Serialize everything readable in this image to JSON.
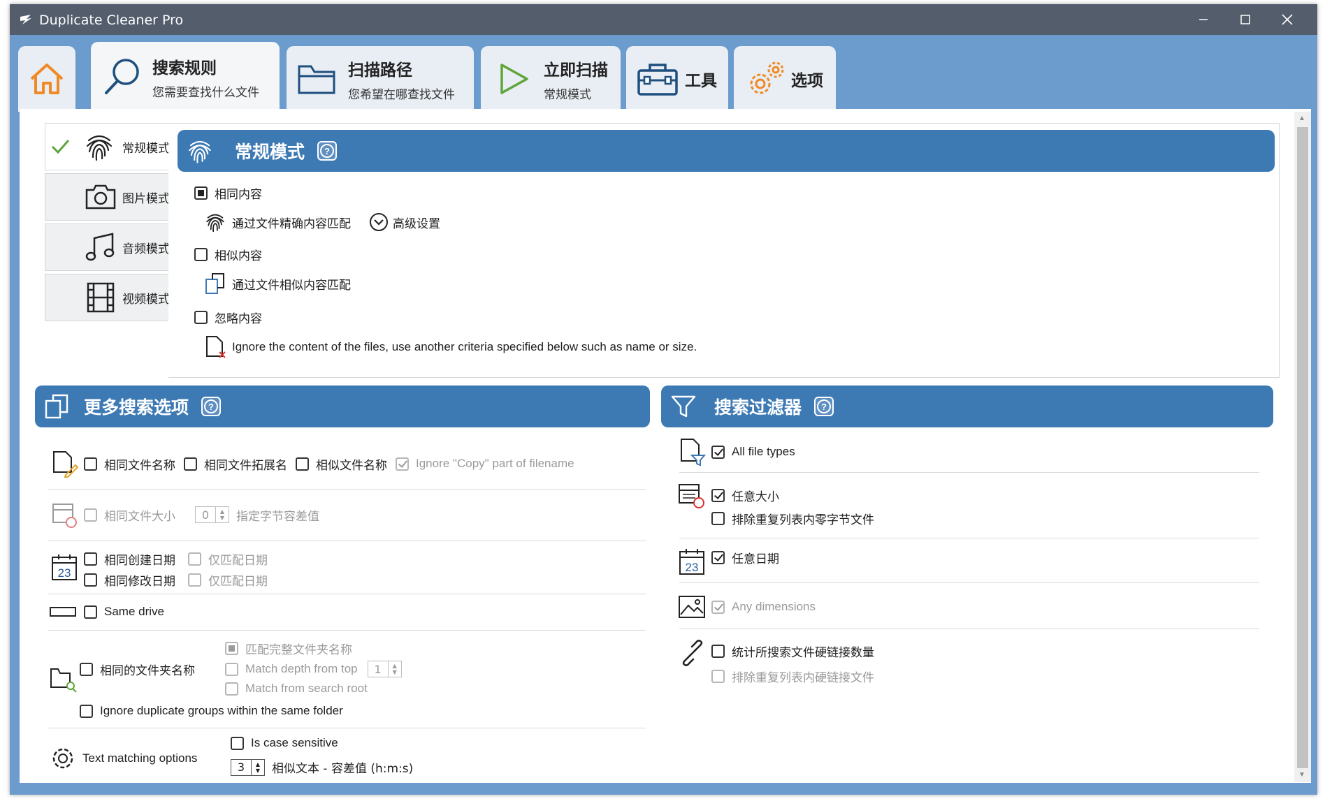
{
  "window": {
    "title": "Duplicate Cleaner Pro"
  },
  "tabs": [
    {
      "id": "home",
      "label": "",
      "sub": ""
    },
    {
      "id": "search",
      "label": "搜索规则",
      "sub": "您需要查找什么文件"
    },
    {
      "id": "paths",
      "label": "扫描路径",
      "sub": "您希望在哪查找文件"
    },
    {
      "id": "scan",
      "label": "立即扫描",
      "sub": "常规模式"
    },
    {
      "id": "tools",
      "label": "工具",
      "sub": ""
    },
    {
      "id": "options",
      "label": "选项",
      "sub": ""
    }
  ],
  "modes": [
    {
      "label": "常规模式",
      "selected": true
    },
    {
      "label": "图片模式",
      "selected": false
    },
    {
      "label": "音频模式",
      "selected": false
    },
    {
      "label": "视频模式",
      "selected": false
    }
  ],
  "mode_panel": {
    "title": "常规模式",
    "same_content": "相同内容",
    "same_content_desc": "通过文件精确内容匹配",
    "advanced": "高级设置",
    "similar_content": "相似内容",
    "similar_content_desc": "通过文件相似内容匹配",
    "ignore_content": "忽略内容",
    "ignore_content_desc": "Ignore the content of the files, use another criteria specified below such as name or size."
  },
  "more_options": {
    "title": "更多搜索选项",
    "same_name": "相同文件名称",
    "same_ext": "相同文件拓展名",
    "similar_name": "相似文件名称",
    "ignore_copy": "Ignore \"Copy\" part of filename",
    "same_size": "相同文件大小",
    "size_value": "0",
    "size_tolerance": "指定字节容差值",
    "same_created": "相同创建日期",
    "date_only_1": "仅匹配日期",
    "same_modified": "相同修改日期",
    "date_only_2": "仅匹配日期",
    "same_drive": "Same drive",
    "match_full_folder": "匹配完整文件夹名称",
    "same_folder_name": "相同的文件夹名称",
    "match_depth": "Match depth from top",
    "depth_value": "1",
    "match_root": "Match from search root",
    "ignore_groups": "Ignore duplicate groups within the same folder",
    "text_matching": "Text matching options",
    "case_sensitive": "Is case sensitive",
    "similar_text_value": "3",
    "similar_text": "相似文本 - 容差值 (h:m:s)"
  },
  "filters": {
    "title": "搜索过滤器",
    "all_types": "All file types",
    "any_size": "任意大小",
    "exclude_zero": "排除重复列表内零字节文件",
    "any_date": "任意日期",
    "any_dimensions": "Any dimensions",
    "count_hardlinks": "统计所搜索文件硬链接数量",
    "exclude_hardlinks": "排除重复列表内硬链接文件"
  },
  "date_icon_text": "23",
  "colors": {
    "titlebar": "#535d6c",
    "frame": "#6c9bcd",
    "header": "#3d7ab4",
    "accent_orange": "#f08a24",
    "accent_green": "#5fa53c"
  }
}
